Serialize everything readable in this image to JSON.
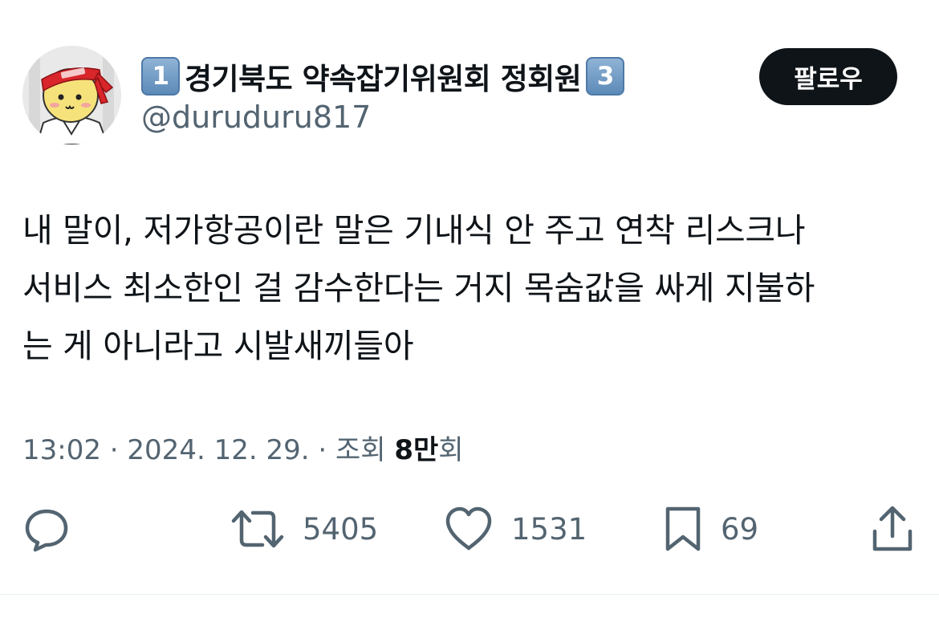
{
  "author": {
    "display_name_prefix": "1",
    "display_name": "경기북도 약속잡기위원회 정회원",
    "display_name_suffix": "3",
    "handle": "@duruduru817",
    "avatar_icon": "avatar-icon"
  },
  "follow_button": {
    "label": "팔로우"
  },
  "tweet": {
    "lines": [
      "내 말이, 저가항공이란 말은 기내식 안 주고 연착 리스크나",
      "서비스 최소한인 걸 감수한다는 거지 목숨값을 싸게 지불하",
      "는 게 아니라고 시발새끼들아"
    ]
  },
  "meta": {
    "time": "13:02",
    "separator": " · ",
    "date": "2024. 12. 29.",
    "views_label": "조회",
    "views_number": "8만",
    "views_unit": "회"
  },
  "actions": {
    "reply": {
      "icon": "reply-icon"
    },
    "retweet": {
      "icon": "retweet-icon",
      "count": "5405"
    },
    "like": {
      "icon": "heart-icon",
      "count": "1531"
    },
    "bookmark": {
      "icon": "bookmark-icon",
      "count": "69"
    },
    "share": {
      "icon": "share-icon"
    }
  },
  "colors": {
    "text": "#0f1419",
    "secondary": "#536471",
    "button_bg": "#0f1419",
    "button_text": "#ffffff",
    "keycap": "#6a95c4"
  }
}
